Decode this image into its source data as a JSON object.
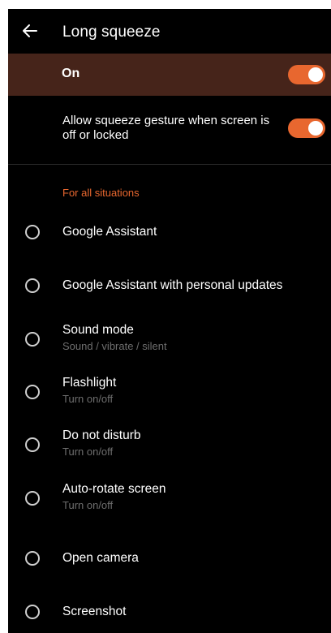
{
  "header": {
    "title": "Long squeeze",
    "back_icon": "arrow-back-icon"
  },
  "master": {
    "label": "On",
    "enabled": true,
    "background": "#46241a"
  },
  "locked": {
    "label": "Allow squeeze gesture when screen is off or locked",
    "enabled": true
  },
  "section": {
    "header": "For all situations"
  },
  "colors": {
    "accent": "#e8672f",
    "background": "#000000",
    "subtitle": "#6e6e6e"
  },
  "options": [
    {
      "title": "Google Assistant",
      "subtitle": ""
    },
    {
      "title": "Google Assistant with personal updates",
      "subtitle": ""
    },
    {
      "title": "Sound mode",
      "subtitle": "Sound / vibrate / silent"
    },
    {
      "title": "Flashlight",
      "subtitle": "Turn on/off"
    },
    {
      "title": "Do not disturb",
      "subtitle": "Turn on/off"
    },
    {
      "title": "Auto-rotate screen",
      "subtitle": "Turn on/off"
    },
    {
      "title": "Open camera",
      "subtitle": ""
    },
    {
      "title": "Screenshot",
      "subtitle": ""
    }
  ]
}
